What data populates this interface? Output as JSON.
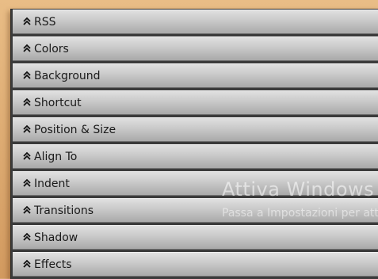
{
  "panel": {
    "sections": [
      {
        "label": "RSS",
        "icon": "double-chevron-up-icon"
      },
      {
        "label": "Colors",
        "icon": "double-chevron-up-icon"
      },
      {
        "label": "Background",
        "icon": "double-chevron-up-icon"
      },
      {
        "label": "Shortcut",
        "icon": "double-chevron-up-icon"
      },
      {
        "label": "Position & Size",
        "icon": "double-chevron-up-icon"
      },
      {
        "label": "Align To",
        "icon": "double-chevron-up-icon"
      },
      {
        "label": "Indent",
        "icon": "double-chevron-up-icon"
      },
      {
        "label": "Transitions",
        "icon": "double-chevron-up-icon"
      },
      {
        "label": "Shadow",
        "icon": "double-chevron-up-icon"
      },
      {
        "label": "Effects",
        "icon": "double-chevron-up-icon"
      }
    ]
  },
  "watermark": {
    "title": "Attiva Windows",
    "subtitle": "Passa a Impostazioni per attivare Windows."
  },
  "colors": {
    "background": "#d9a772",
    "header_gradient_top": "#e0e0e0",
    "header_gradient_bottom": "#a9a9a9",
    "text": "#1a1a1a"
  }
}
